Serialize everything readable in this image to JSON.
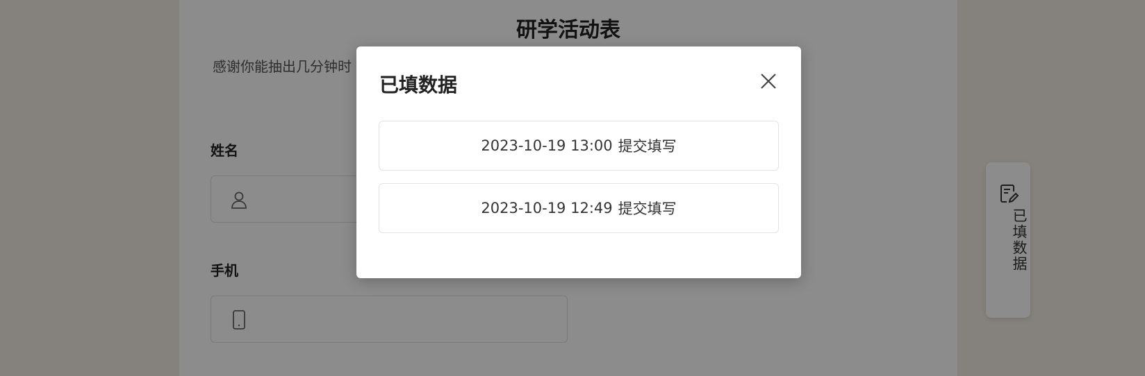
{
  "form": {
    "title": "研学活动表",
    "description": "感谢你能抽出几分钟时",
    "fields": [
      {
        "label": "姓名",
        "icon": "user-icon"
      },
      {
        "label": "手机",
        "icon": "phone-icon"
      }
    ]
  },
  "side_button": {
    "label": "已填数据",
    "icon": "edit-document-icon"
  },
  "modal": {
    "title": "已填数据",
    "close_icon": "close-icon",
    "records": [
      {
        "time": "2023-10-19 13:00",
        "action": "提交填写"
      },
      {
        "time": "2023-10-19 12:49",
        "action": "提交填写"
      }
    ]
  }
}
